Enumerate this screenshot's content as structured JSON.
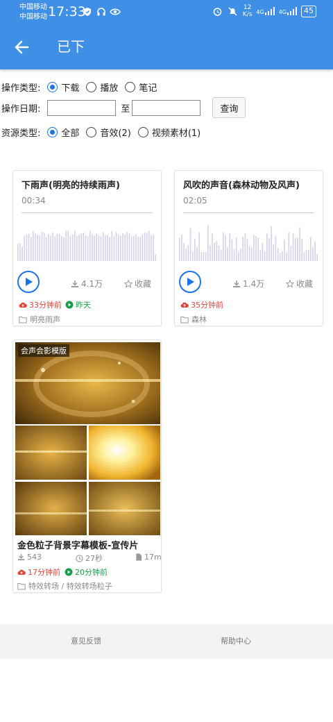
{
  "status_bar": {
    "carrier_1": "中国移动",
    "carrier_2": "中国移动",
    "time": "17:33",
    "net_speed_top": "12",
    "net_speed_bottom": "K/s",
    "signal_1": "4G",
    "signal_2": "4G",
    "battery": "45"
  },
  "header": {
    "title": "已下",
    "back_icon": "arrow-left-icon"
  },
  "filters": {
    "op_type_label": "操作类型:",
    "op_types": [
      {
        "label": "下载",
        "selected": true
      },
      {
        "label": "播放",
        "selected": false
      },
      {
        "label": "笔记",
        "selected": false
      }
    ],
    "op_date_label": "操作日期:",
    "date_from": "",
    "date_to": "",
    "date_sep": "至",
    "query_label": "查询",
    "res_type_label": "资源类型:",
    "res_types": [
      {
        "label": "全部",
        "selected": true
      },
      {
        "label": "音效(2)",
        "selected": false
      },
      {
        "label": "视频素材(1)",
        "selected": false
      }
    ]
  },
  "audio_items": [
    {
      "title": "下雨声(明亮的持续雨声)",
      "duration": "00:34",
      "downloads": "4.1万",
      "favorite_label": "收藏",
      "uploaded": "33分钟前",
      "played": "昨天",
      "category": "明亮雨声"
    },
    {
      "title": "风吹的声音(森林动物及风声)",
      "duration": "02:05",
      "downloads": "1.4万",
      "favorite_label": "收藏",
      "uploaded": "35分钟前",
      "played": "",
      "category": "森林"
    }
  ],
  "video_items": [
    {
      "badge": "会声会影模版",
      "title": "金色粒子背景字幕模板-宣传片",
      "downloads": "543",
      "duration": "27秒",
      "size": "17m",
      "uploaded": "17分钟前",
      "played": "20分钟前",
      "category": "特效转场 / 特效转场粒子"
    }
  ],
  "footer": {
    "feedback": "意见反馈",
    "help": "帮助中心"
  },
  "colors": {
    "primary": "#3f8fe6",
    "accent": "#1a73e8",
    "red": "#e0463b",
    "green": "#1a9e4b",
    "wave": "#d6d0ea"
  }
}
